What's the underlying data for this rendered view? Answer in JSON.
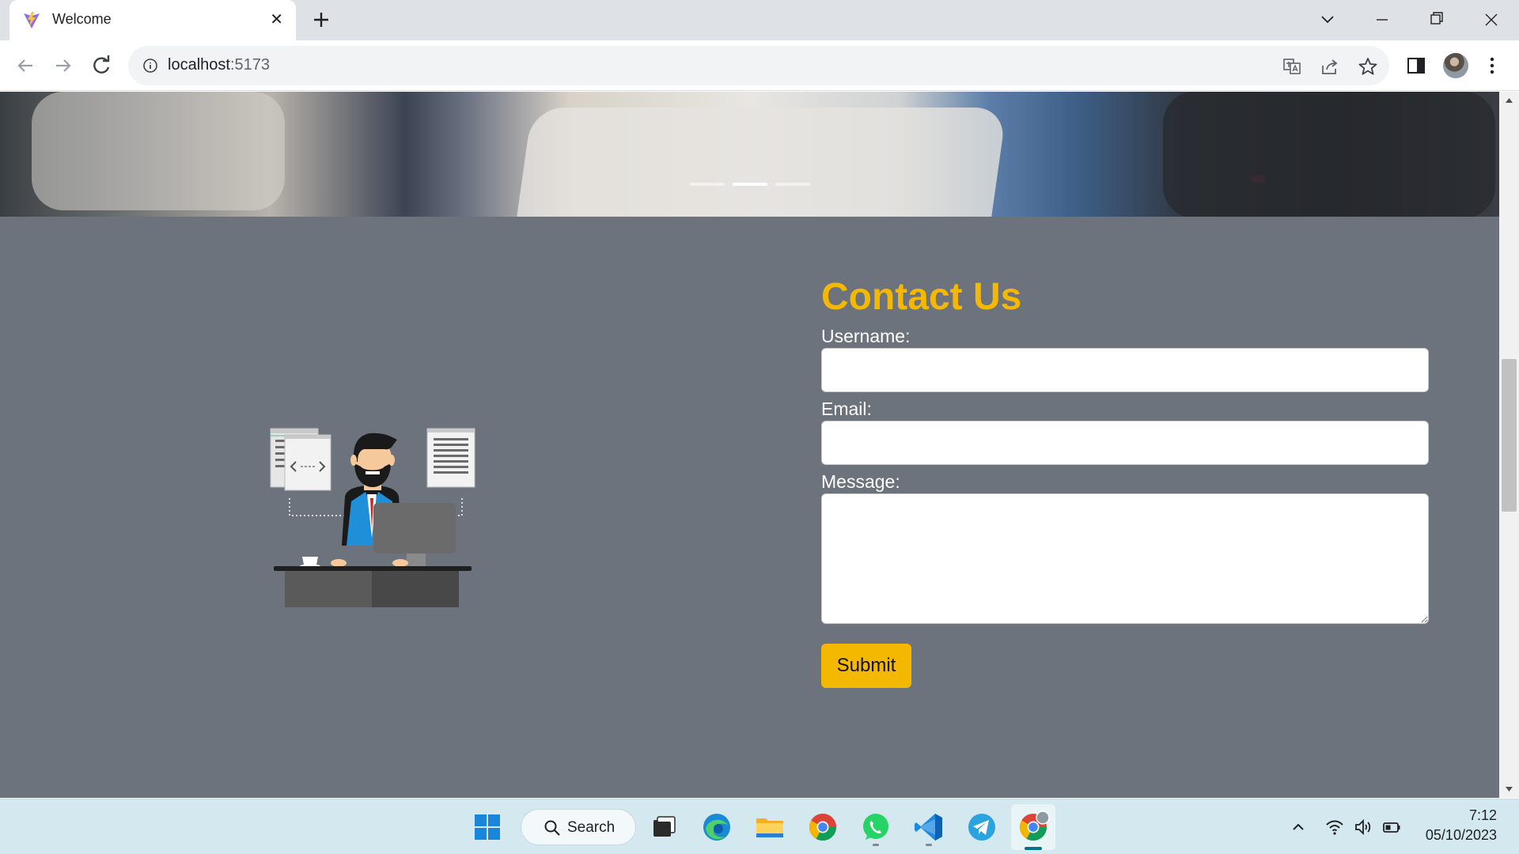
{
  "browser": {
    "tab_title": "Welcome",
    "address": {
      "host": "localhost",
      "port": ":5173"
    },
    "icons": {
      "favicon": "vite-logo-icon",
      "close": "close-icon",
      "new_tab": "plus-icon",
      "tab_search": "chevron-down-icon",
      "back": "arrow-left-icon",
      "forward": "arrow-right-icon",
      "reload": "reload-icon",
      "site_info": "info-icon",
      "translate": "translate-icon",
      "share": "share-icon",
      "bookmark": "star-icon",
      "side_panel": "side-panel-icon",
      "menu": "kebab-menu-icon"
    }
  },
  "page": {
    "carousel": {
      "slides": 3,
      "active_index": 1
    },
    "contact": {
      "title": "Contact Us",
      "username_label": "Username:",
      "username_value": "",
      "email_label": "Email:",
      "email_value": "",
      "message_label": "Message:",
      "message_value": "",
      "submit_label": "Submit"
    },
    "colors": {
      "section_bg": "#6c737d",
      "accent": "#f5b800"
    }
  },
  "taskbar": {
    "search_label": "Search",
    "apps": [
      "start-icon",
      "task-view-icon",
      "edge-icon",
      "file-explorer-icon",
      "chrome-icon",
      "whatsapp-icon",
      "vscode-icon",
      "telegram-icon",
      "chrome-profile-icon"
    ],
    "tray_icons": [
      "chevron-up-icon",
      "wifi-icon",
      "speaker-icon",
      "battery-icon"
    ],
    "clock": {
      "time": "7:12",
      "date": "05/10/2023"
    }
  }
}
